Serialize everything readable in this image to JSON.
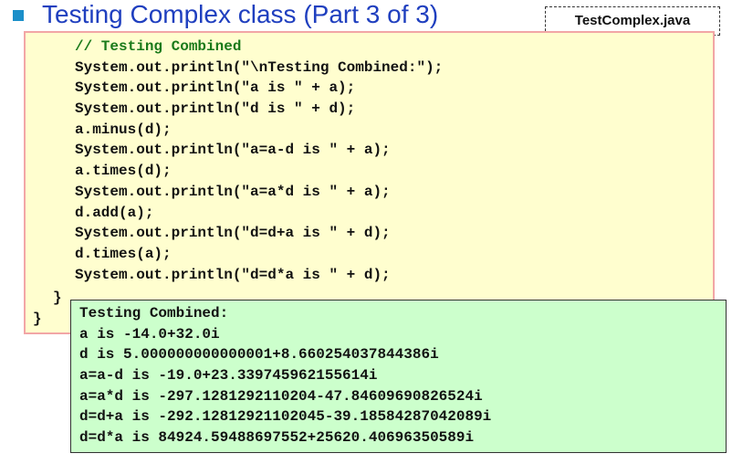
{
  "slide": {
    "title": "Testing Complex class (Part 3 of 3)",
    "file_label": "TestComplex.java"
  },
  "code": {
    "lines": [
      "// Testing Combined",
      "System.out.println(\"\\nTesting Combined:\");",
      "System.out.println(\"a is \" + a);",
      "System.out.println(\"d is \" + d);",
      "a.minus(d);",
      "System.out.println(\"a=a-d is \" + a);",
      "a.times(d);",
      "System.out.println(\"a=a*d is \" + a);",
      "d.add(a);",
      "System.out.println(\"d=d+a is \" + d);",
      "d.times(a);",
      "System.out.println(\"d=d*a is \" + d);"
    ],
    "closing_brace_inner": "}",
    "closing_brace_outer": "}"
  },
  "output": {
    "lines": [
      "Testing Combined:",
      "a is -14.0+32.0i",
      "d is 5.000000000000001+8.660254037844386i",
      "a=a-d is -19.0+23.339745962155614i",
      "a=a*d is -297.1281292110204-47.84609690826524i",
      "d=d+a is -292.12812921102045-39.18584287042089i",
      "d=d*a is 84924.59488697552+25620.40696350589i"
    ]
  },
  "colors": {
    "title": "#1f3fbf",
    "bullet": "#1b8fc9",
    "code_background": "#fffecf",
    "code_border": "#f2a6a6",
    "comment": "#1a7a1a",
    "output_background": "#ccffcc"
  }
}
